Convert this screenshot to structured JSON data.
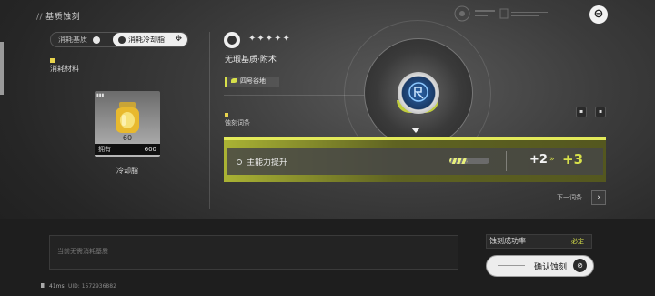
{
  "header": {
    "title": "基质蚀刻",
    "slash": "//"
  },
  "left_panel": {
    "toggle": {
      "option_a": "消耗基质",
      "option_b": "消耗冷却脂",
      "option_b_plus": "✥"
    },
    "materials_label": "消耗材料",
    "item": {
      "value": "60",
      "owned_label": "拥有",
      "owned_count": "600",
      "name": "冷却脂"
    }
  },
  "center": {
    "stars": "✦✦✦✦✦",
    "subtitle": "无瑕基质·附术",
    "location": "四号谷地",
    "section_label": "蚀刻词条",
    "attribute": {
      "name": "主能力提升",
      "progress": 0.45,
      "current": "+2",
      "arrow": "»",
      "next": "+3"
    },
    "next_entry_label": "下一词条",
    "next_icon": "›"
  },
  "bottom": {
    "note_placeholder": "当前无需消耗基质",
    "success_rate_label": "蚀刻成功率",
    "success_rate_value": "必定",
    "confirm_label": "确认蚀刻",
    "confirm_icon": "⊘",
    "ping": "41ms",
    "uid": "UID: 1572936882"
  },
  "colors": {
    "accent": "#d7e04a",
    "bar_top": "#e3ea5a",
    "background": "#2b2b2b"
  },
  "icons": [
    "close-icon",
    "toggle-plus-icon",
    "trash-icon",
    "lock-icon",
    "leaf-icon",
    "chevron-right-icon",
    "confirm-icon"
  ]
}
